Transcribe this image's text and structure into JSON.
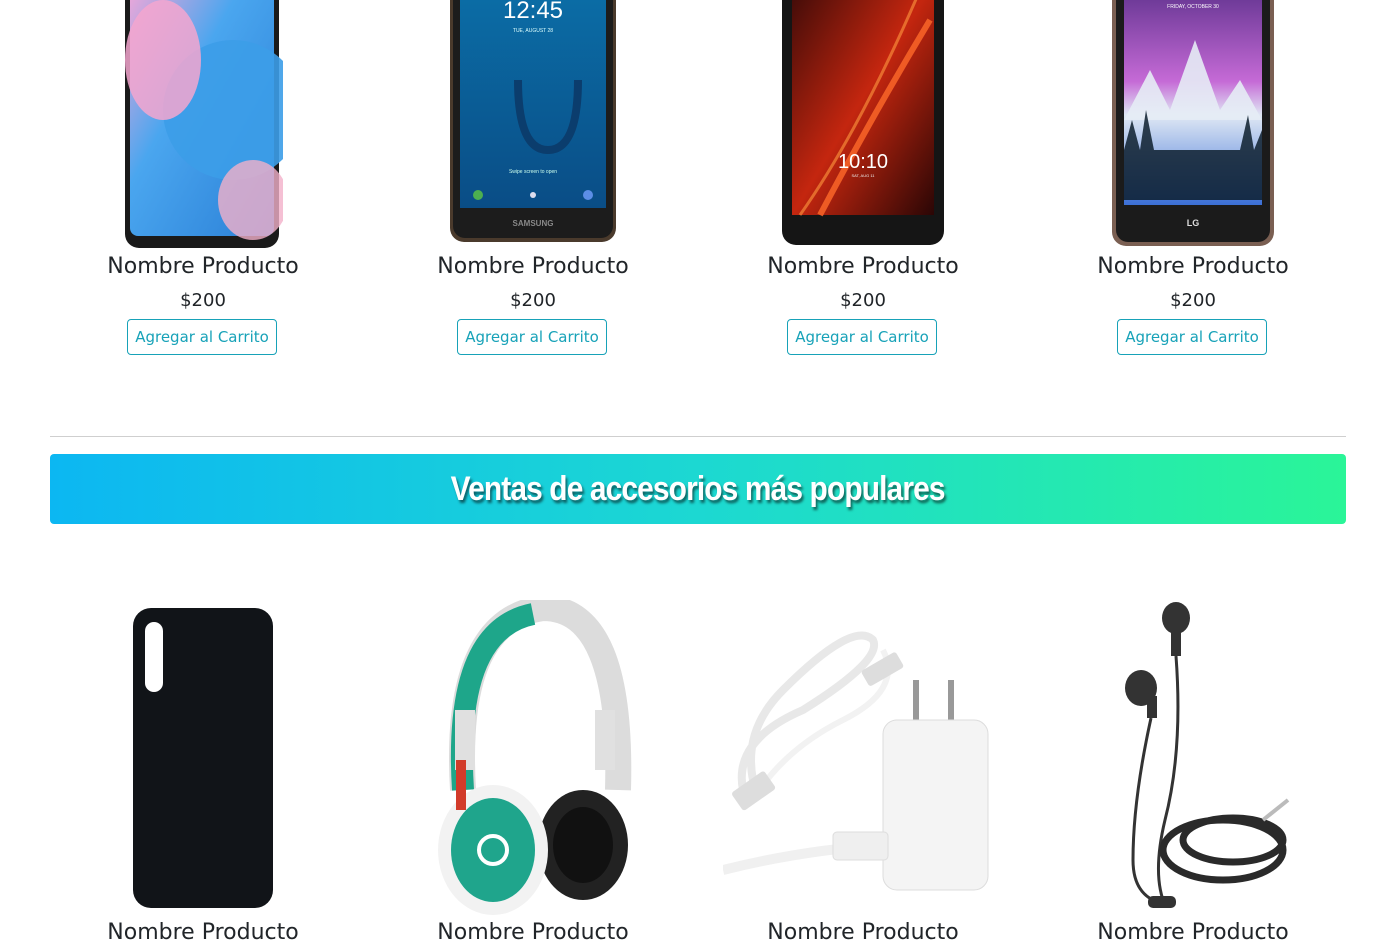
{
  "phones": [
    {
      "name": "Nombre Producto",
      "price": "$200",
      "button": "Agregar al Carrito"
    },
    {
      "name": "Nombre Producto",
      "price": "$200",
      "button": "Agregar al Carrito",
      "screen_time": "12:45",
      "screen_date": "TUE, AUGUST 28",
      "screen_hint": "Swipe screen to open",
      "brand": "SAMSUNG"
    },
    {
      "name": "Nombre Producto",
      "price": "$200",
      "button": "Agregar al Carrito",
      "screen_time": "10:10",
      "screen_date": "SAT, AUG 11"
    },
    {
      "name": "Nombre Producto",
      "price": "$200",
      "button": "Agregar al Carrito",
      "screen_date": "FRIDAY, OCTOBER 30",
      "brand": "LG"
    }
  ],
  "section": {
    "title": "Ventas de accesorios más populares"
  },
  "accessories": [
    {
      "name": "Nombre Producto",
      "icon": "phone-case"
    },
    {
      "name": "Nombre Producto",
      "icon": "headphones"
    },
    {
      "name": "Nombre Producto",
      "icon": "charger"
    },
    {
      "name": "Nombre Producto",
      "icon": "earphones"
    }
  ],
  "colors": {
    "accent": "#17a2b8",
    "banner_start": "#0cb7f2",
    "banner_end": "#2af598"
  }
}
